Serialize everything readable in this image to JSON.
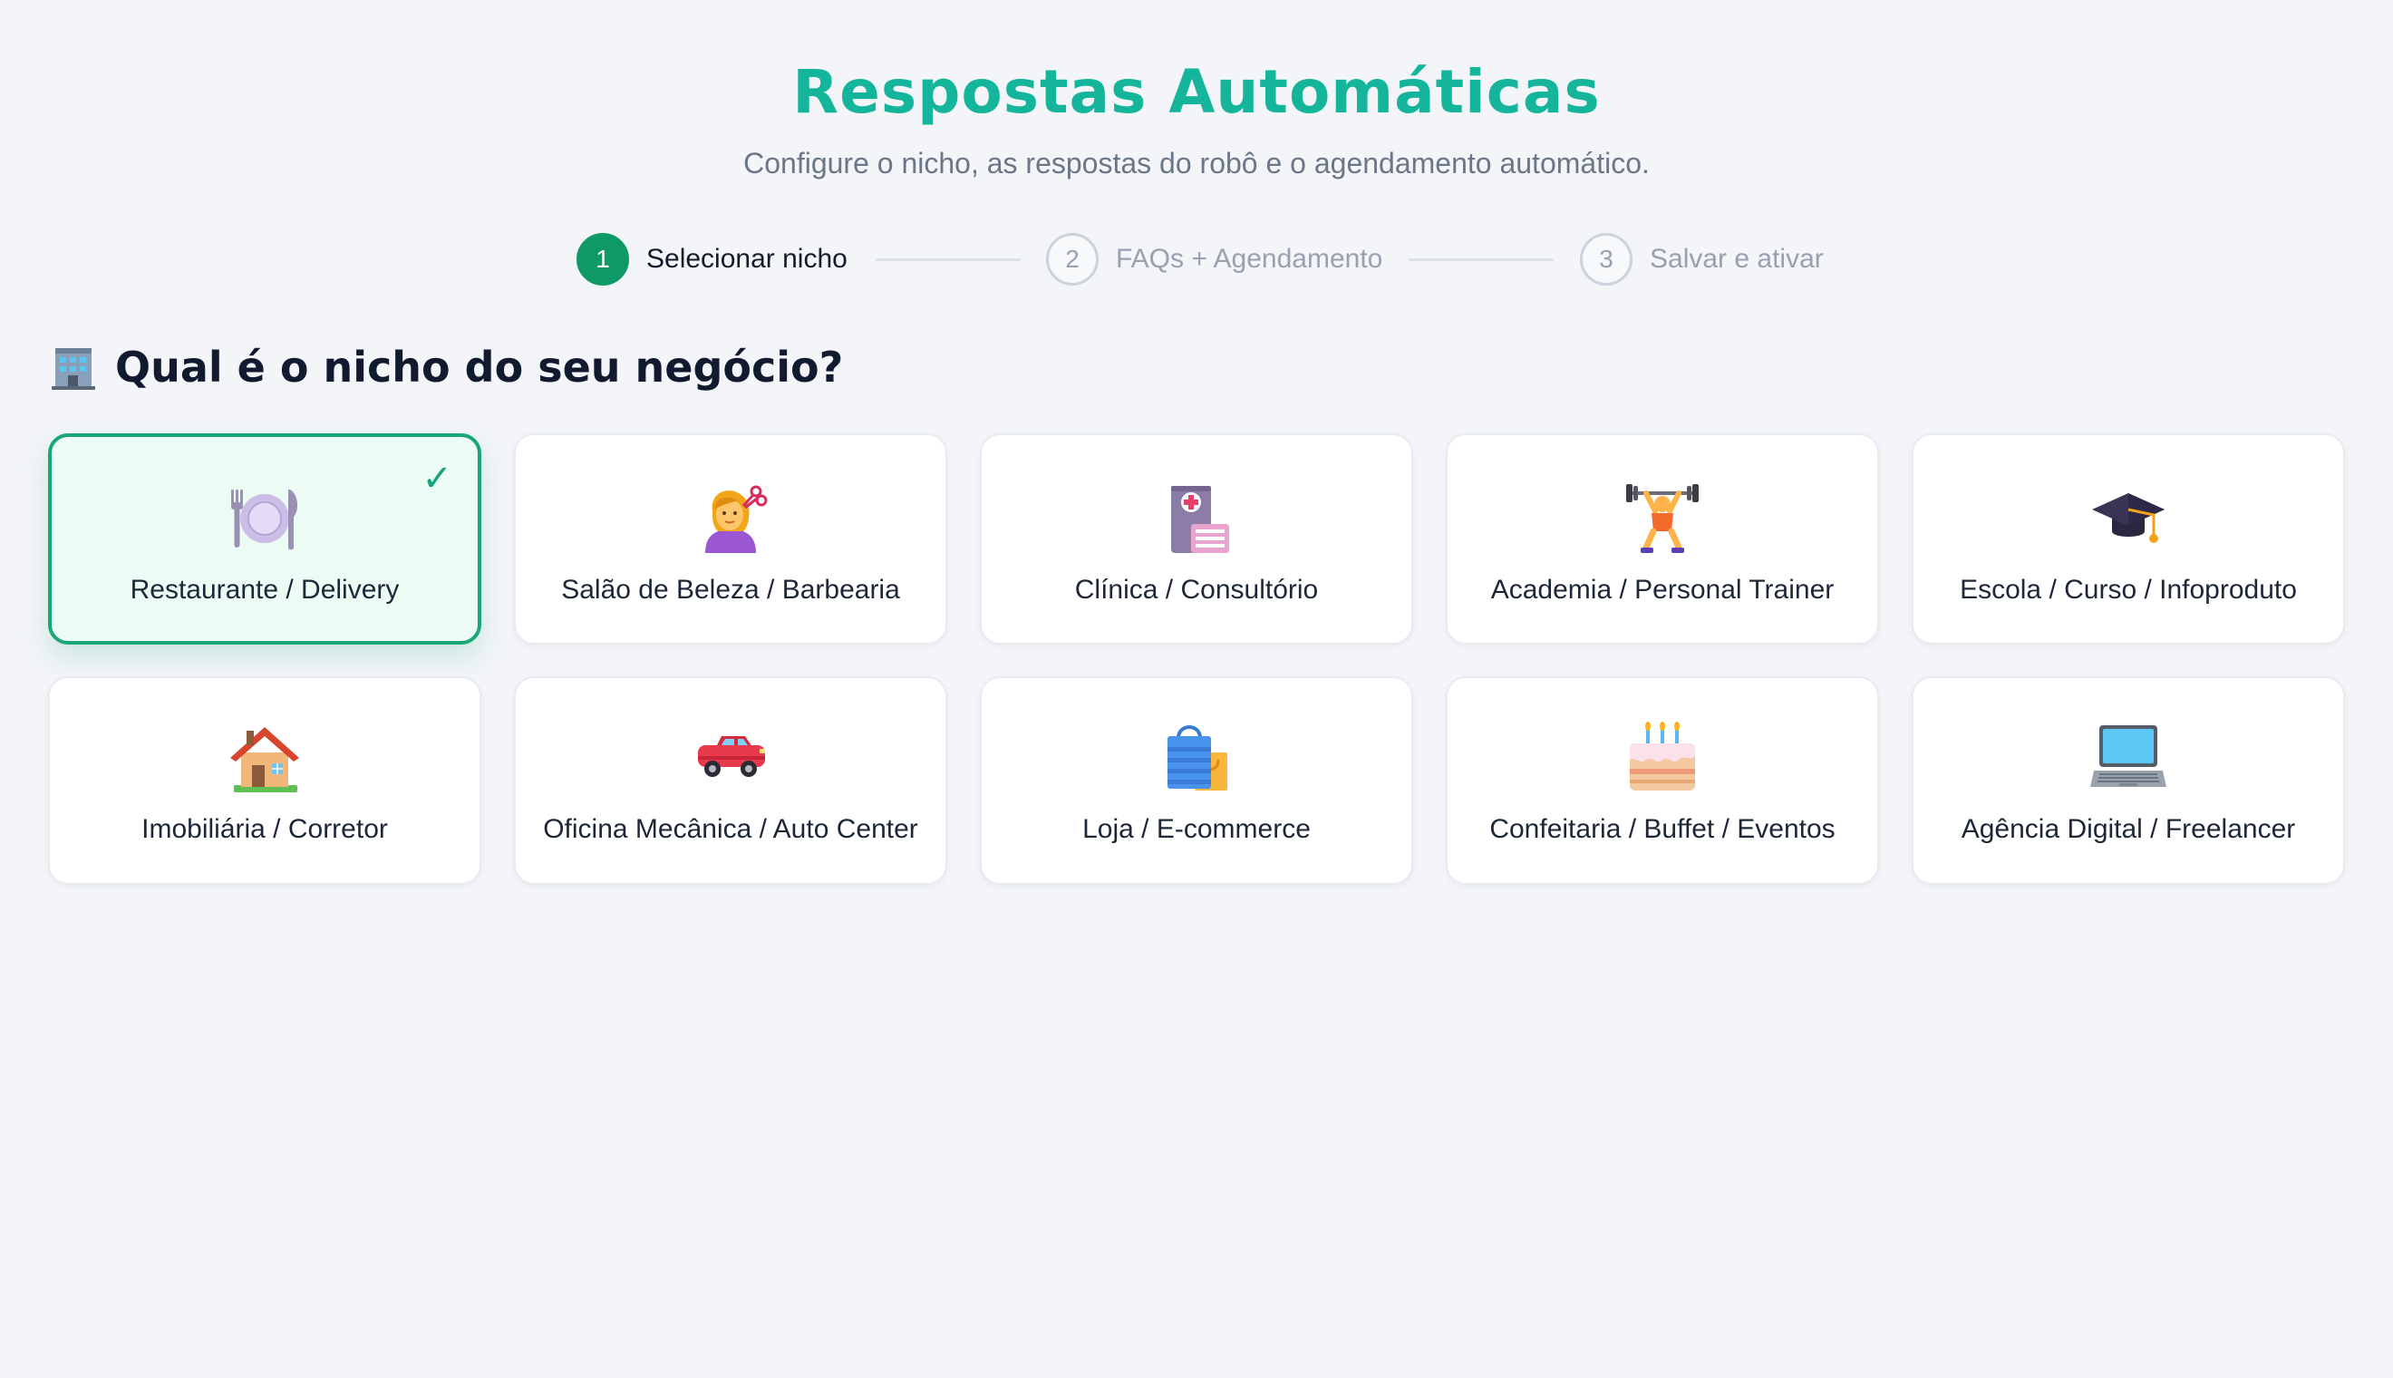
{
  "header": {
    "title": "Respostas Automáticas",
    "subtitle": "Configure o nicho, as respostas do robô e o agendamento automático."
  },
  "stepper": {
    "steps": [
      {
        "number": "1",
        "label": "Selecionar nicho",
        "state": "active"
      },
      {
        "number": "2",
        "label": "FAQs + Agendamento",
        "state": "inactive"
      },
      {
        "number": "3",
        "label": "Salvar e ativar",
        "state": "inactive"
      }
    ]
  },
  "section": {
    "icon": "office-building-icon",
    "title": "Qual é o nicho do seu negócio?"
  },
  "niches": [
    {
      "label": "Restaurante / Delivery",
      "icon": "plate-cutlery-icon",
      "selected": true
    },
    {
      "label": "Salão de Beleza / Barbearia",
      "icon": "haircut-icon",
      "selected": false
    },
    {
      "label": "Clínica / Consultório",
      "icon": "hospital-icon",
      "selected": false
    },
    {
      "label": "Academia / Personal Trainer",
      "icon": "weightlifter-icon",
      "selected": false
    },
    {
      "label": "Escola / Curso / Infoproduto",
      "icon": "graduation-cap-icon",
      "selected": false
    },
    {
      "label": "Imobiliária / Corretor",
      "icon": "house-icon",
      "selected": false
    },
    {
      "label": "Oficina Mecânica / Auto Center",
      "icon": "car-icon",
      "selected": false
    },
    {
      "label": "Loja / E-commerce",
      "icon": "shopping-bags-icon",
      "selected": false
    },
    {
      "label": "Confeitaria / Buffet / Eventos",
      "icon": "birthday-cake-icon",
      "selected": false
    },
    {
      "label": "Agência Digital / Freelancer",
      "icon": "laptop-icon",
      "selected": false
    }
  ],
  "selected_mark": "✓",
  "colors": {
    "brand": "#15b59b",
    "active_step": "#0f9966",
    "selected_border": "#19a77a",
    "selected_background": "#ecfcf5",
    "page_background": "#f3f5f8"
  }
}
